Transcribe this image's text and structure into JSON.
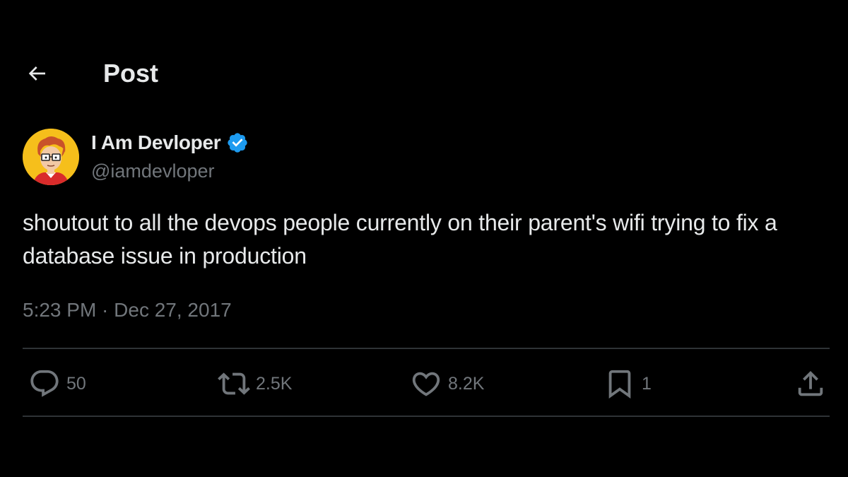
{
  "header": {
    "back_icon": "arrow-left-icon",
    "title": "Post"
  },
  "author": {
    "name": "I Am Devloper",
    "handle": "@iamdevloper",
    "verified": true,
    "verified_color": "#1d9bf0",
    "avatar_bg": "#f6bf1b"
  },
  "post": {
    "text": "shoutout to all the devops people currently on their parent's wifi trying to fix a database issue in production",
    "timestamp": "5:23 PM · Dec 27, 2017"
  },
  "actions": {
    "replies": "50",
    "reposts": "2.5K",
    "likes": "8.2K",
    "bookmarks": "1",
    "share_icon": "share-icon"
  },
  "colors": {
    "background": "#000000",
    "text_primary": "#e7e9ea",
    "text_secondary": "#71767b",
    "divider": "#2f3336"
  }
}
